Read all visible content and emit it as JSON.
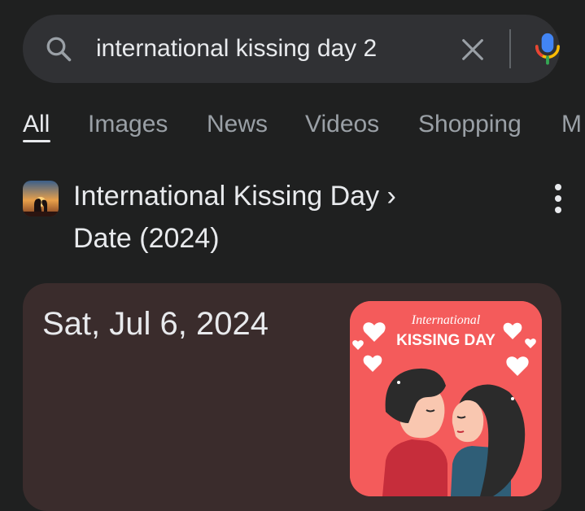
{
  "search": {
    "query": "international kissing day 2",
    "icons": {
      "search": "search-icon",
      "clear": "close-icon",
      "voice": "mic-icon"
    }
  },
  "tabs": [
    {
      "label": "All",
      "active": true
    },
    {
      "label": "Images",
      "active": false
    },
    {
      "label": "News",
      "active": false
    },
    {
      "label": "Videos",
      "active": false
    },
    {
      "label": "Shopping",
      "active": false
    },
    {
      "label": "M",
      "active": false
    }
  ],
  "result": {
    "title": "International Kissing Day",
    "chevron": "›",
    "subtitle": "Date (2024)",
    "favicon": "couple-silhouette-sunset-image"
  },
  "card": {
    "date": "Sat, Jul 6, 2024",
    "image_script": "International",
    "image_heading": "KISSING DAY"
  },
  "colors": {
    "background": "#1f2020",
    "search_bg": "#303134",
    "card_bg": "#3a2c2c",
    "image_bg": "#f45b5b",
    "text": "#e8eaed",
    "muted": "#9aa0a6"
  }
}
